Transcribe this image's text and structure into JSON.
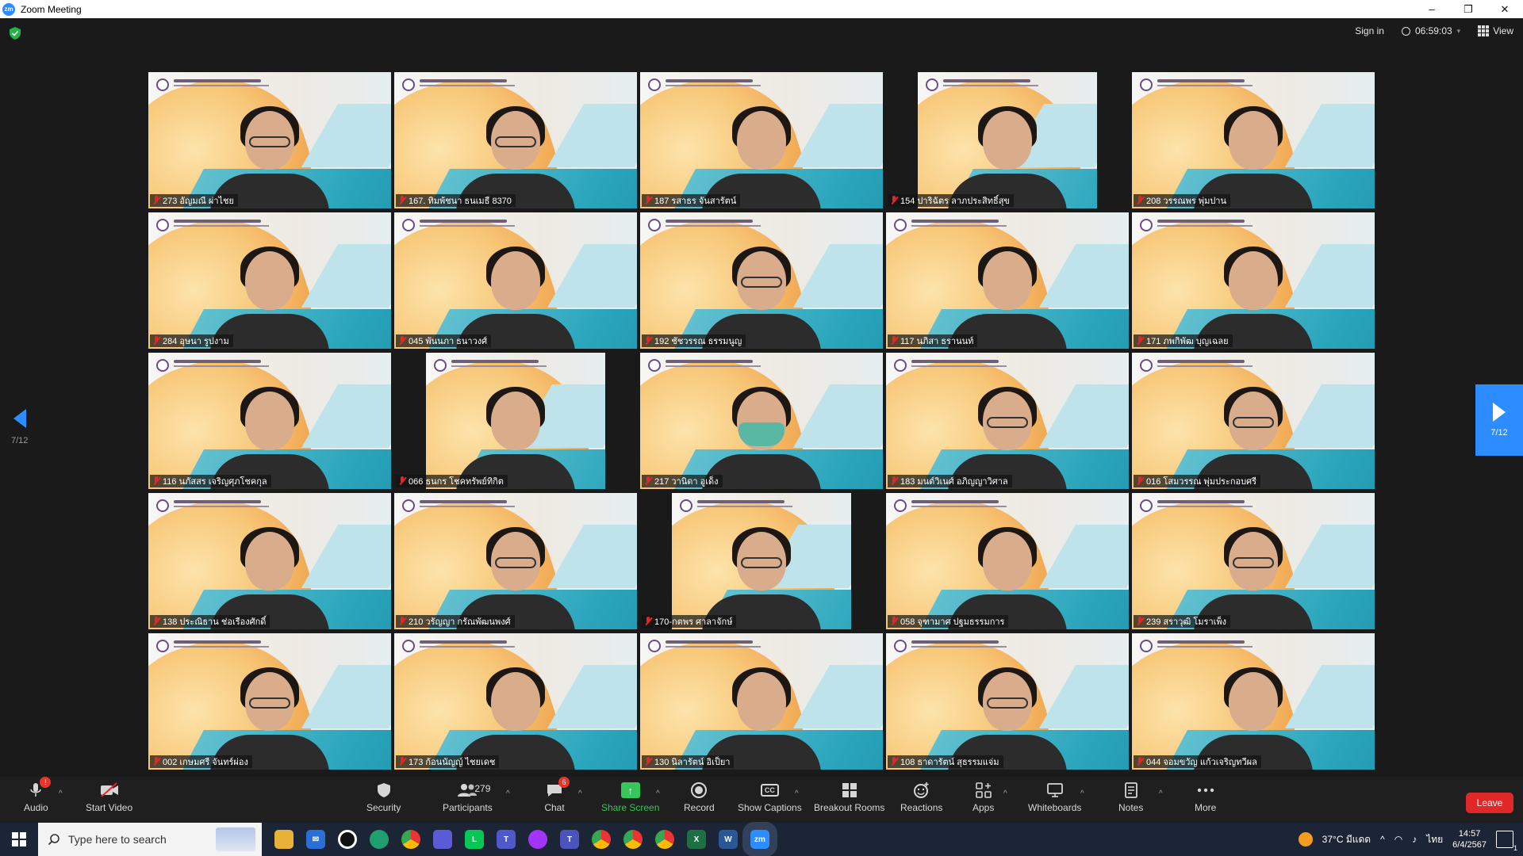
{
  "window": {
    "title": "Zoom Meeting",
    "minimize": "–",
    "restore": "❐",
    "close": "✕"
  },
  "topbar": {
    "sign_in": "Sign in",
    "timer": "06:59:03",
    "view": "View"
  },
  "pagination": {
    "left_label": "7/12",
    "right_label": "7/12"
  },
  "participants": [
    {
      "name": "273 อัญมณี ผ่าไชย",
      "glasses": true,
      "mask": false,
      "narrow": false
    },
    {
      "name": "167. ทิมพ้ชนา ธนเมธี 8370",
      "glasses": true,
      "mask": false,
      "narrow": false
    },
    {
      "name": "187 รสาธร จันสารัตน์",
      "glasses": false,
      "mask": false,
      "narrow": false
    },
    {
      "name": "154 ปาริฉัตร ลาภประสิทธิ์สุข",
      "glasses": false,
      "mask": false,
      "narrow": true
    },
    {
      "name": "208 วรรณพร พุ่มปาน",
      "glasses": false,
      "mask": false,
      "narrow": false
    },
    {
      "name": "284 อุษนา รูปงาม",
      "glasses": false,
      "mask": false,
      "narrow": false
    },
    {
      "name": "045 พันนภา ธนาวงศ์",
      "glasses": false,
      "mask": false,
      "narrow": false
    },
    {
      "name": "192 ชัชวรรณ ธรรมนูญ",
      "glasses": true,
      "mask": false,
      "narrow": false
    },
    {
      "name": "117 นภิสา ธรานนท์",
      "glasses": false,
      "mask": false,
      "narrow": false
    },
    {
      "name": "171 ภพกิพัฒ บุญเฉลย",
      "glasses": false,
      "mask": false,
      "narrow": false
    },
    {
      "name": "116 นภัสสร เจริญศุภโชคกุล",
      "glasses": false,
      "mask": false,
      "narrow": false
    },
    {
      "name": "066 ธนกร โชคทรัพย์ทิกิต",
      "glasses": false,
      "mask": false,
      "narrow": true
    },
    {
      "name": "217 วานิดา อูเด็ง",
      "glasses": false,
      "mask": true,
      "narrow": false
    },
    {
      "name": "183 มนต์วิเนศ์ อภิญญาวิศาล",
      "glasses": true,
      "mask": false,
      "narrow": false
    },
    {
      "name": "016 โสมวรรณ พุ่มประกอบศรี",
      "glasses": true,
      "mask": false,
      "narrow": false
    },
    {
      "name": "138 ประณิธาน ช่อเรืองศักดิ์",
      "glasses": false,
      "mask": false,
      "narrow": false
    },
    {
      "name": "210 วรัญญา กรัณพัฒนพงศ์",
      "glasses": true,
      "mask": false,
      "narrow": false
    },
    {
      "name": "170-กตพร ศาลาจักษ์",
      "glasses": true,
      "mask": false,
      "narrow": true
    },
    {
      "name": "058 จุฑามาศ ปฐมธรรมการ",
      "glasses": false,
      "mask": false,
      "narrow": false
    },
    {
      "name": "239 สราวุฒิ โมราเพ็ง",
      "glasses": true,
      "mask": false,
      "narrow": false
    },
    {
      "name": "002 เกษมศรี จันทร์ผ่อง",
      "glasses": true,
      "mask": false,
      "narrow": false
    },
    {
      "name": "173 ก้อนนัญญ์ ไชยเดช",
      "glasses": false,
      "mask": false,
      "narrow": false
    },
    {
      "name": "130 นิลารัตน์ อิเป็ยา",
      "glasses": false,
      "mask": false,
      "narrow": false
    },
    {
      "name": "108 ธาดารัตน์ สุธรรมแจ่ม",
      "glasses": true,
      "mask": false,
      "narrow": false
    },
    {
      "name": "044 จอมขวัญ แก้วเจริญทวีผล",
      "glasses": false,
      "mask": false,
      "narrow": false
    }
  ],
  "toolbar": {
    "audio": "Audio",
    "start_video": "Start Video",
    "security": "Security",
    "participants": "Participants",
    "participants_count": "279",
    "chat": "Chat",
    "chat_badge": "6",
    "share_screen": "Share Screen",
    "record": "Record",
    "show_captions": "Show Captions",
    "captions_icon": "CC",
    "breakout_rooms": "Breakout Rooms",
    "reactions": "Reactions",
    "apps": "Apps",
    "whiteboards": "Whiteboards",
    "notes": "Notes",
    "more": "More",
    "leave": "Leave"
  },
  "taskbar": {
    "search_placeholder": "Type here to search",
    "weather": "37°C มีแดด",
    "language": "ไทย",
    "time": "14:57",
    "date": "6/4/2567",
    "notification_count": "1"
  },
  "colors": {
    "accent": "#2d8cff",
    "leave": "#e02828",
    "share": "#35c759"
  },
  "icons": [
    "shield-icon",
    "clock-icon",
    "grid-view-icon",
    "mic-off-icon",
    "video-off-icon",
    "security-icon",
    "participants-icon",
    "chat-icon",
    "share-screen-icon",
    "record-icon",
    "captions-icon",
    "breakout-rooms-icon",
    "reactions-icon",
    "apps-icon",
    "whiteboard-icon",
    "notes-icon",
    "more-icon"
  ]
}
